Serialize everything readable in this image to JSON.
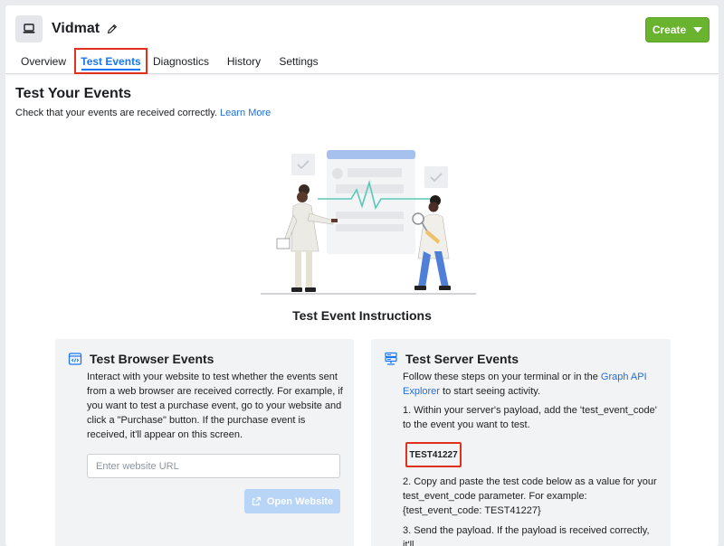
{
  "app": {
    "title": "Vidmat",
    "icon": "laptop-icon",
    "edit_icon": "pencil-icon"
  },
  "toolbar": {
    "create_label": "Create"
  },
  "tabs": [
    {
      "label": "Overview",
      "active": false
    },
    {
      "label": "Test Events",
      "active": true
    },
    {
      "label": "Diagnostics",
      "active": false
    },
    {
      "label": "History",
      "active": false
    },
    {
      "label": "Settings",
      "active": false
    }
  ],
  "page": {
    "title": "Test Your Events",
    "subtitle": "Check that your events are received correctly.",
    "learn_more": "Learn More",
    "instructions_title": "Test Event Instructions"
  },
  "browser_card": {
    "title": "Test Browser Events",
    "icon": "code-window-icon",
    "description": "Interact with your website to test whether the events sent from a web browser are received correctly. For example, if you want to test a purchase event, go to your website and click a \"Purchase\" button. If the purchase event is received, it'll appear on this screen.",
    "input_placeholder": "Enter website URL",
    "input_value": "",
    "button_label": "Open Website",
    "button_icon": "external-link-icon"
  },
  "server_card": {
    "title": "Test Server Events",
    "icon": "server-icon",
    "intro_before": "Follow these steps on your terminal or in the ",
    "intro_link": "Graph API Explorer",
    "intro_after": " to start seeing activity.",
    "step1": "1. Within your server's payload, add the 'test_event_code' to the event you want to test.",
    "test_code": "TEST41227",
    "step2": "2. Copy and paste the test code below as a value for your test_event_code parameter. For example: {test_event_code: TEST41227}",
    "step3": "3. Send the payload. If the payload is received correctly, it'll"
  },
  "colors": {
    "accent": "#1877f2",
    "create_green": "#69b32f",
    "highlight_red": "#e0301e",
    "link": "#216fdb",
    "card_bg": "#f2f3f5"
  }
}
